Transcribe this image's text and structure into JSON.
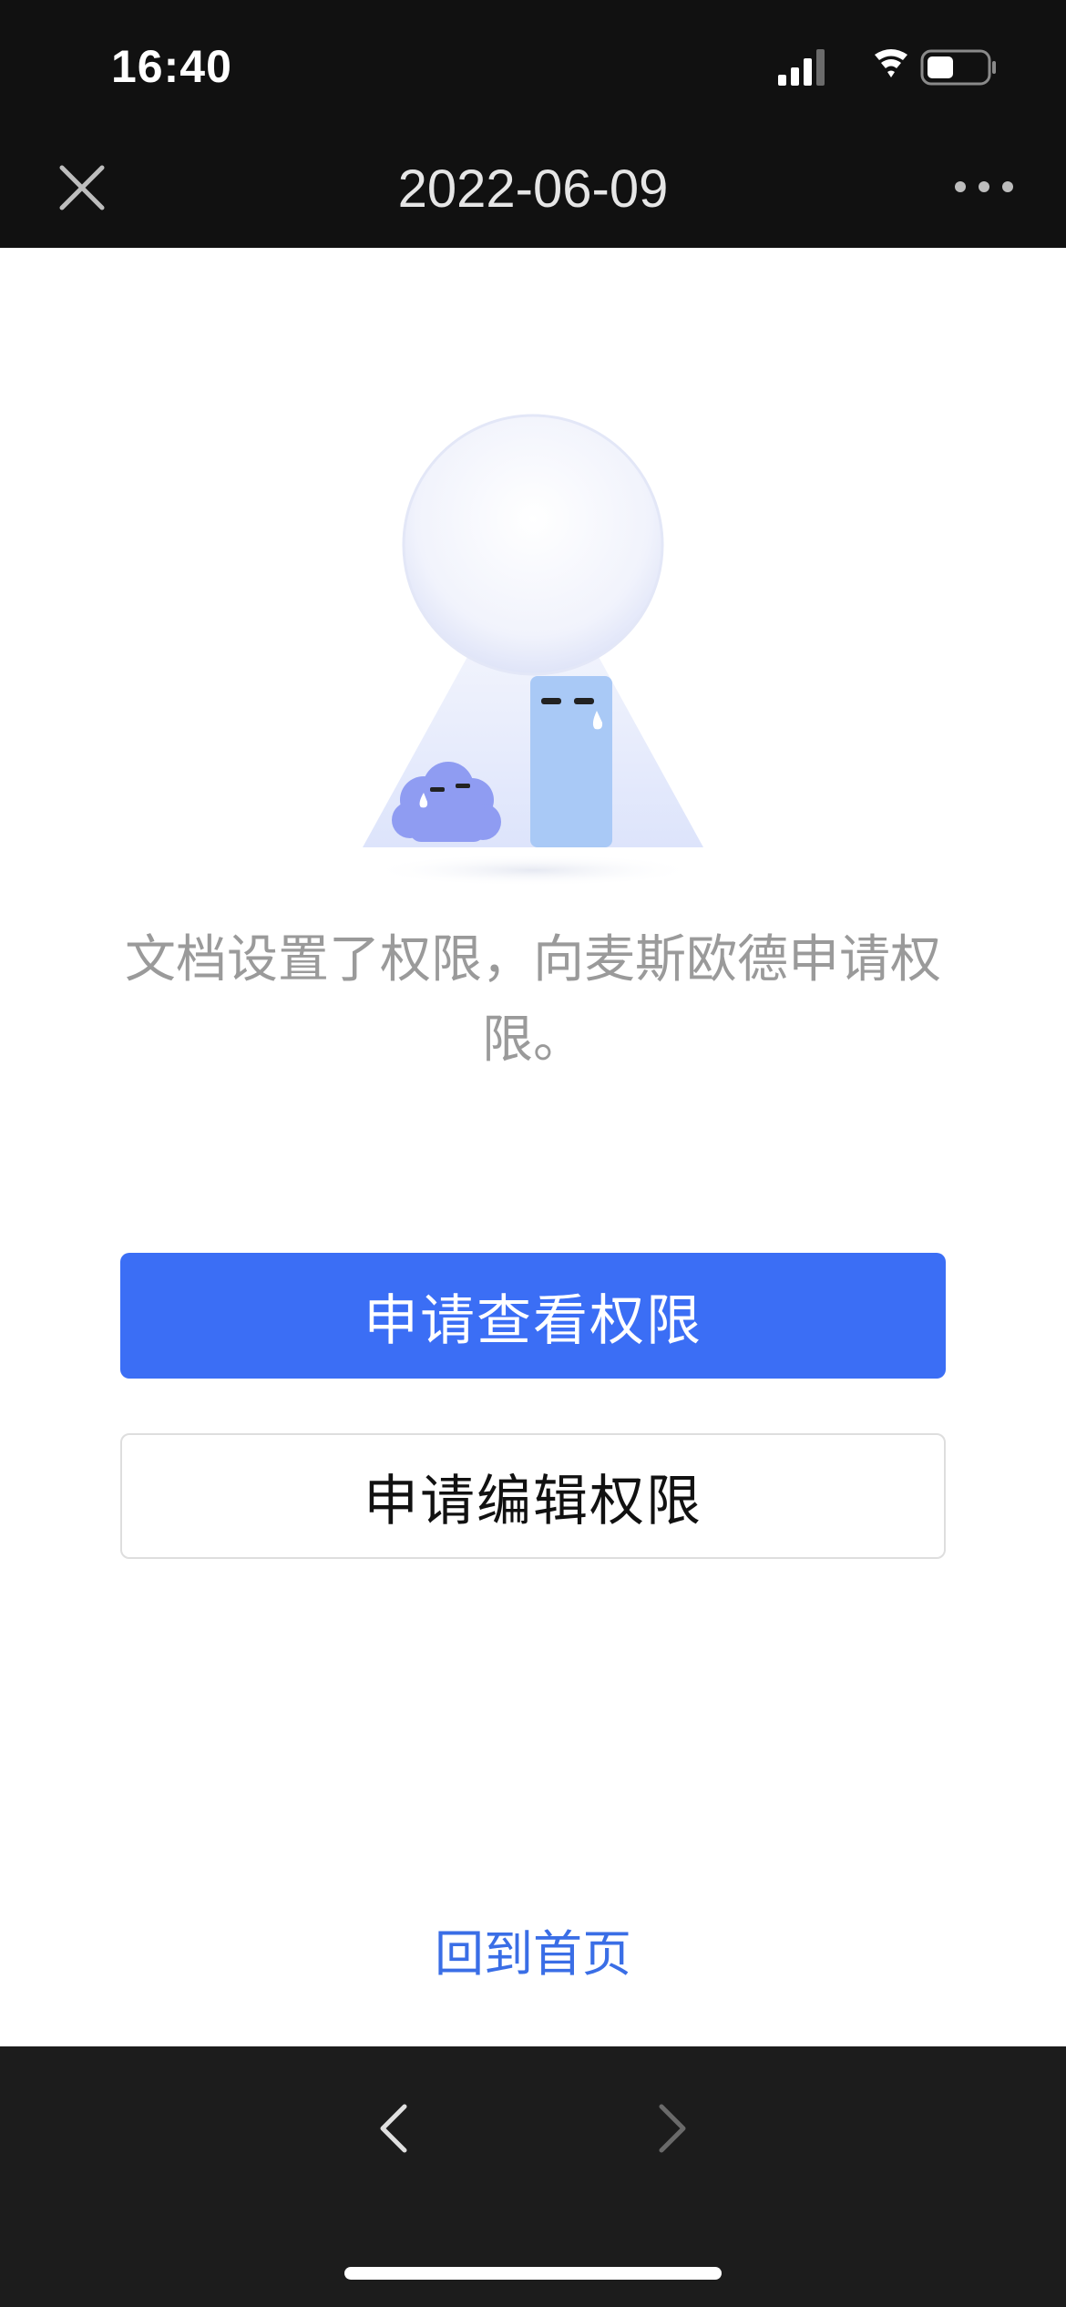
{
  "status_bar": {
    "time": "16:40"
  },
  "nav": {
    "title": "2022-06-09",
    "close_icon": "close-icon",
    "more_icon": "more-icon"
  },
  "content": {
    "message": "文档设置了权限，向麦斯欧德申请权限。",
    "request_view_label": "申请查看权限",
    "request_edit_label": "申请编辑权限",
    "home_link_label": "回到首页"
  },
  "toolbar": {
    "back_icon": "chevron-left-icon",
    "forward_icon": "chevron-right-icon"
  },
  "colors": {
    "primary": "#3b6ef5",
    "link": "#3a6ee6",
    "dark_bar": "#111111",
    "bottom_bar": "#1c1c1c"
  }
}
